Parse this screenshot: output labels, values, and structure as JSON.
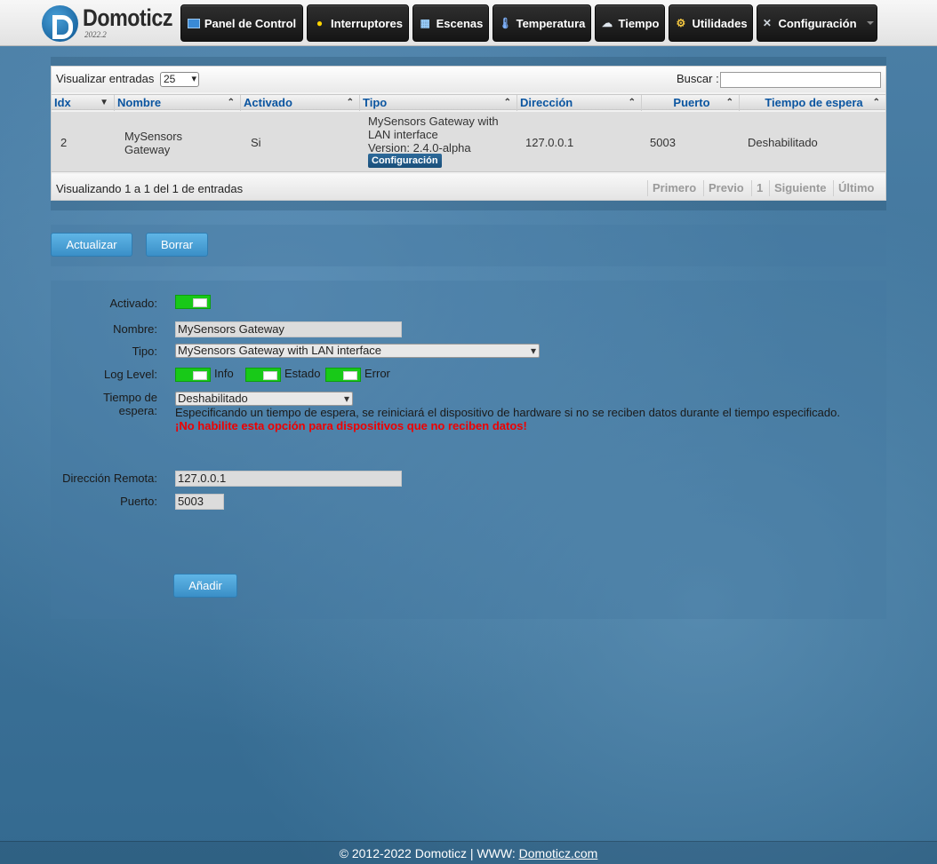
{
  "header": {
    "brand": "Domoticz",
    "version": "2022.2",
    "nav": [
      {
        "label": "Panel de Control",
        "icon": "monitor-icon"
      },
      {
        "label": "Interruptores",
        "icon": "lightbulb-icon"
      },
      {
        "label": "Escenas",
        "icon": "clapperboard-icon"
      },
      {
        "label": "Temperatura",
        "icon": "thermometer-icon"
      },
      {
        "label": "Tiempo",
        "icon": "cloud-icon"
      },
      {
        "label": "Utilidades",
        "icon": "utility-icon"
      },
      {
        "label": "Configuración",
        "icon": "tools-icon"
      }
    ]
  },
  "grid": {
    "length_label": "Visualizar entradas",
    "length_value": "25",
    "search_label": "Buscar :",
    "search_value": "",
    "columns": [
      "Idx",
      "Nombre",
      "Activado",
      "Tipo",
      "Dirección",
      "Puerto",
      "Tiempo de espera"
    ],
    "rows": [
      {
        "idx": "2",
        "name": "MySensors Gateway",
        "enabled": "Si",
        "type": "MySensors Gateway with LAN interface",
        "version": "Version: 2.4.0-alpha",
        "config_button": "Configuración",
        "address": "127.0.0.1",
        "port": "5003",
        "timeout": "Deshabilitado"
      }
    ],
    "info": "Visualizando 1 a 1 del 1 de entradas",
    "pager": {
      "first": "Primero",
      "prev": "Previo",
      "page": "1",
      "next": "Siguiente",
      "last": "Último"
    }
  },
  "actions": {
    "update": "Actualizar",
    "delete": "Borrar"
  },
  "form": {
    "enabled_label": "Activado:",
    "enabled_on": true,
    "name_label": "Nombre:",
    "name_value": "MySensors Gateway",
    "type_label": "Tipo:",
    "type_value": "MySensors Gateway with LAN interface",
    "loglevel_label": "Log Level:",
    "loglevel_info": "Info",
    "loglevel_status": "Estado",
    "loglevel_error": "Error",
    "timeout_label": "Tiempo de espera:",
    "timeout_value": "Deshabilitado",
    "timeout_help": "Especificando un tiempo de espera, se reiniciará el dispositivo de hardware si no se reciben datos durante el tiempo especificado.",
    "timeout_warning": "¡No habilite esta opción para dispositivos que no reciben datos!",
    "remote_label": "Dirección Remota:",
    "remote_value": "127.0.0.1",
    "port_label": "Puerto:",
    "port_value": "5003",
    "add_button": "Añadir"
  },
  "footer": {
    "copyright": "© 2012-2022 Domoticz | WWW: ",
    "link": "Domoticz.com"
  },
  "colors": {
    "accent": "#0b55a0",
    "toggle_on": "#18c918",
    "warning": "#ee0000"
  }
}
